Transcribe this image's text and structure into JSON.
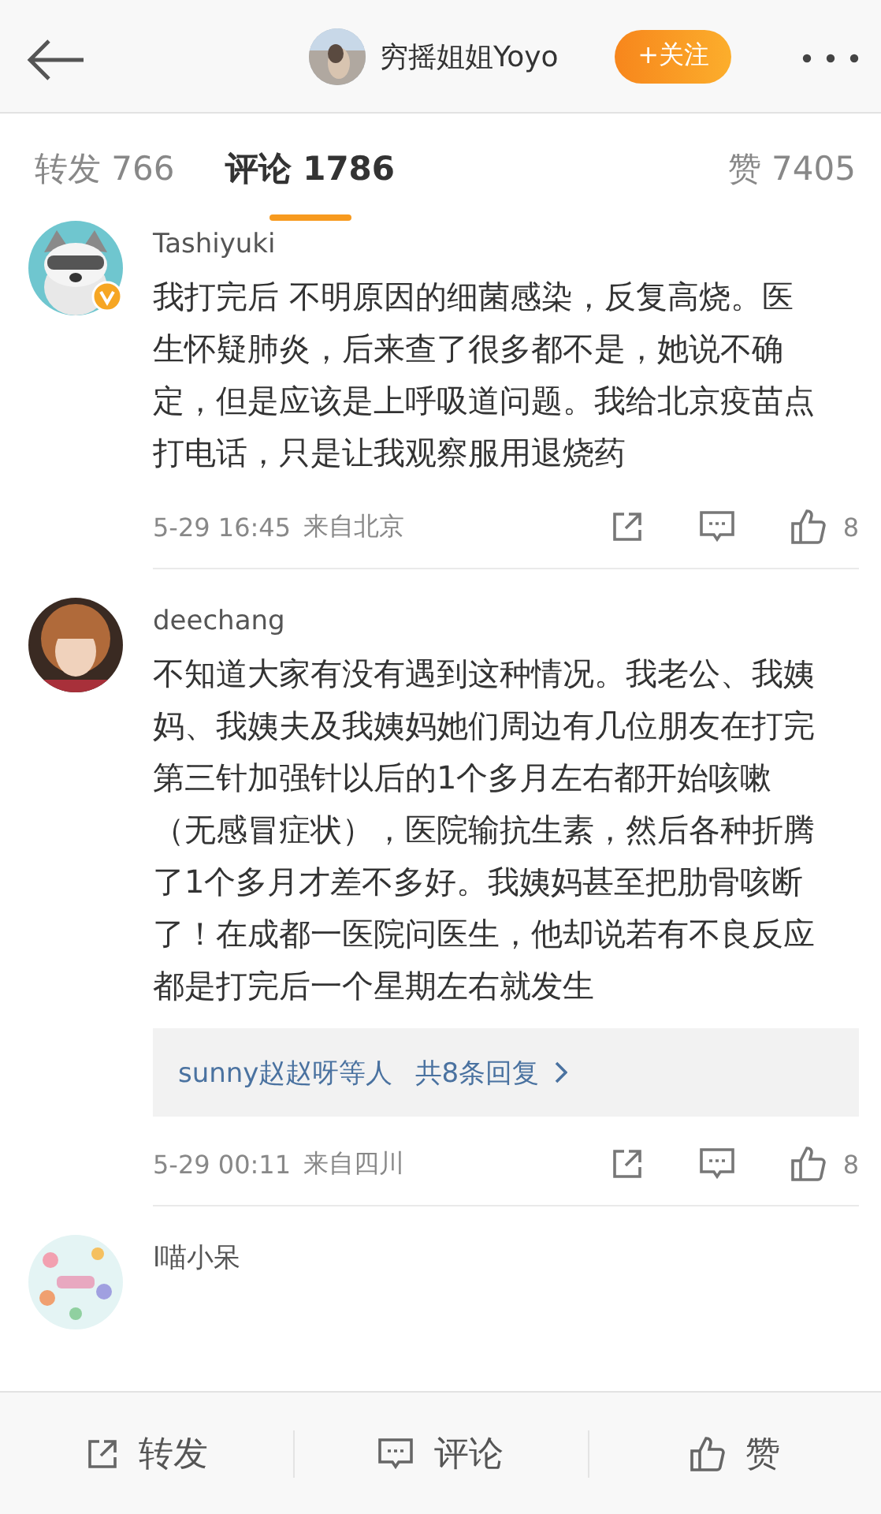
{
  "header": {
    "user": "穷摇姐姐Yoyo",
    "follow_button": "+关注"
  },
  "tabs": [
    {
      "label": "转发",
      "count": "766",
      "selected": false
    },
    {
      "label": "评论",
      "count": "1786",
      "selected": true
    },
    {
      "label": "赞",
      "count": "7405",
      "selected": false
    }
  ],
  "comments": [
    {
      "user": "Tashiyuki",
      "verified": true,
      "text": "我打完后 不明原因的细菌感染，反复高烧。医生怀疑肺炎，后来查了很多都不是，她说不确定，但是应该是上呼吸道问题。我给北京疫苗点打电话，只是让我观察服用退烧药",
      "time": "5-29 16:45",
      "location": "来自北京",
      "likes": "8"
    },
    {
      "user": "deechang",
      "verified": false,
      "text": "不知道大家有没有遇到这种情况。我老公、我姨妈、我姨夫及我姨妈她们周边有几位朋友在打完第三针加强针以后的1个多月左右都开始咳嗽（无感冒症状），医院输抗生素，然后各种折腾了1个多月才差不多好。我姨妈甚至把肋骨咳断了！在成都一医院问医生，他却说若有不良反应都是打完后一个星期左右就发生",
      "replies": {
        "users": "sunny赵赵呀等人",
        "count": "共8条回复"
      },
      "time": "5-29 00:11",
      "location": "来自四川",
      "likes": "8"
    },
    {
      "user": "l喵小呆",
      "verified": false
    }
  ],
  "bottom_bar": [
    {
      "kind": "repost",
      "label": "转发"
    },
    {
      "kind": "comment",
      "label": "评论"
    },
    {
      "kind": "like",
      "label": "赞"
    }
  ]
}
